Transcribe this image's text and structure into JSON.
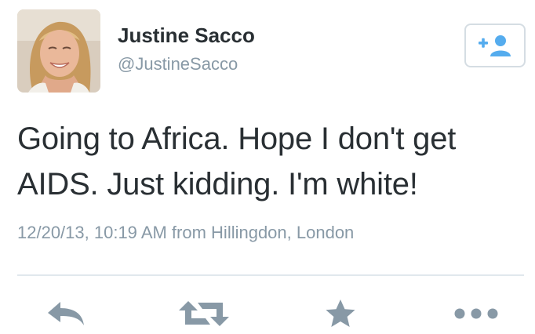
{
  "tweet": {
    "display_name": "Justine Sacco",
    "handle": "@JustineSacco",
    "text": "Going to Africa. Hope I don't get AIDS. Just kidding. I'm white!",
    "timestamp": "12/20/13, 10:19 AM from Hillingdon, London"
  },
  "icons": {
    "avatar": "profile-photo",
    "follow": "follow-icon",
    "reply": "reply-icon",
    "retweet": "retweet-icon",
    "favorite": "star-icon",
    "more": "more-icon"
  },
  "colors": {
    "text": "#292f33",
    "secondary_text": "#8899a6",
    "accent": "#55acee",
    "action_icon": "#8899a6",
    "divider": "#e1e8ed"
  }
}
